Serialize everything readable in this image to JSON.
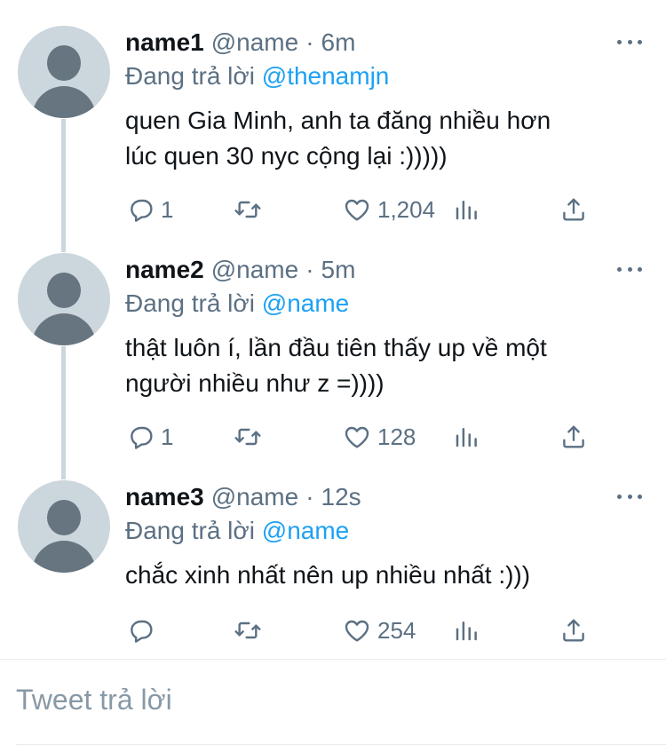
{
  "tweets": [
    {
      "name": "name1",
      "handle": "@name",
      "separator": "·",
      "time": "6m",
      "reply_prefix": "Đang trả lời",
      "reply_to": "@thenamjn",
      "text_lines": [
        "quen Gia Minh, anh ta đăng nhiều hơn",
        "lúc quen 30 nyc cộng lại :)))))"
      ],
      "replies": "1",
      "likes": "1,204"
    },
    {
      "name": "name2",
      "handle": "@name",
      "separator": "·",
      "time": "5m",
      "reply_prefix": "Đang trả lời",
      "reply_to": "@name",
      "text_lines": [
        "thật luôn í, lần đầu tiên thấy up về một",
        "người nhiều như z =))))"
      ],
      "replies": "1",
      "likes": "128"
    },
    {
      "name": "name3",
      "handle": "@name",
      "separator": "·",
      "time": "12s",
      "reply_prefix": "Đang trả lời",
      "reply_to": "@name",
      "text_lines": [
        "chắc xinh nhất nên up nhiều nhất :)))"
      ],
      "replies": "",
      "likes": "254"
    }
  ],
  "compose": {
    "placeholder": "Tweet trả lời"
  },
  "colors": {
    "accent": "#1da1f2",
    "muted": "#5b7083",
    "avatar_bg": "#ccd6dd"
  },
  "icons": [
    "more-icon",
    "reply-icon",
    "retweet-icon",
    "like-icon",
    "analytics-icon",
    "share-icon"
  ]
}
